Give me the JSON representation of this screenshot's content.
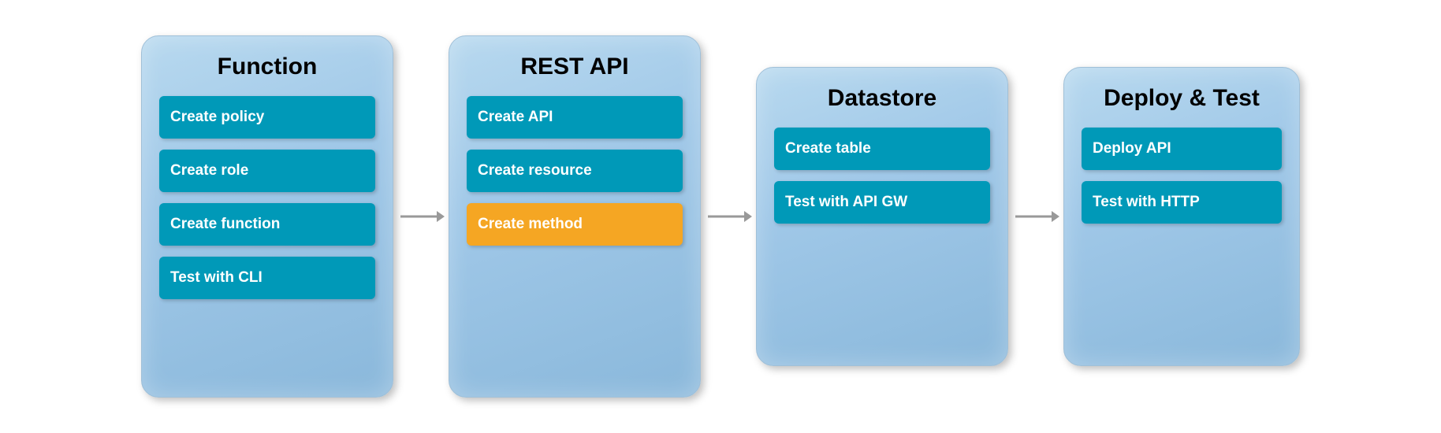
{
  "panels": [
    {
      "id": "function",
      "title": "Function",
      "items": [
        {
          "label": "Create policy",
          "color": "teal"
        },
        {
          "label": "Create role",
          "color": "teal"
        },
        {
          "label": "Create function",
          "color": "teal"
        },
        {
          "label": "Test with CLI",
          "color": "teal"
        }
      ]
    },
    {
      "id": "rest-api",
      "title": "REST API",
      "items": [
        {
          "label": "Create API",
          "color": "teal"
        },
        {
          "label": "Create resource",
          "color": "teal"
        },
        {
          "label": "Create method",
          "color": "orange"
        }
      ]
    },
    {
      "id": "datastore",
      "title": "Datastore",
      "items": [
        {
          "label": "Create table",
          "color": "teal"
        },
        {
          "label": "Test with API GW",
          "color": "teal"
        }
      ]
    },
    {
      "id": "deploy-test",
      "title": "Deploy & Test",
      "items": [
        {
          "label": "Deploy API",
          "color": "teal"
        },
        {
          "label": "Test with HTTP",
          "color": "teal"
        }
      ]
    }
  ],
  "arrows": [
    {
      "id": "arrow-1"
    },
    {
      "id": "arrow-2"
    },
    {
      "id": "arrow-3"
    }
  ]
}
